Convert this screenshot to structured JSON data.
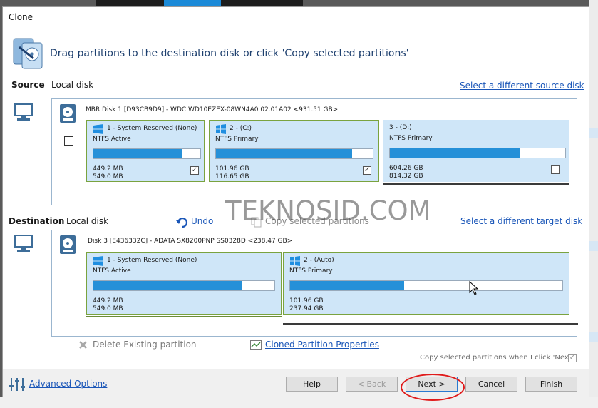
{
  "window": {
    "title": "Clone"
  },
  "header": {
    "instruction": "Drag partitions to the destination disk or click 'Copy selected partitions'"
  },
  "source": {
    "label": "Source",
    "sublabel": "Local disk",
    "select_link": "Select a different source disk",
    "disk_title": "MBR Disk 1 [D93CB9D9] - WDC WD10EZEX-08WN4A0 02.01A02  <931.51 GB>",
    "partitions": [
      {
        "name": "1 - System Reserved (None)",
        "fs": "NTFS Active",
        "used": "449.2 MB",
        "total": "549.0 MB",
        "fill": 0.83,
        "checked": true,
        "has_logo": true
      },
      {
        "name": "2 - (C:)",
        "fs": "NTFS Primary",
        "used": "101.96 GB",
        "total": "116.65 GB",
        "fill": 0.87,
        "checked": true,
        "has_logo": true
      },
      {
        "name": "3 - (D:)",
        "fs": "NTFS Primary",
        "used": "604.26 GB",
        "total": "814.32 GB",
        "fill": 0.74,
        "checked": false,
        "has_logo": false
      }
    ]
  },
  "destination": {
    "label": "Destination",
    "sublabel": "Local disk",
    "undo": "Undo",
    "copy_selected": "Copy selected partitions",
    "select_link": "Select a different target disk",
    "disk_title": "Disk 3 [E436332C] - ADATA SX8200PNP SS0328D  <238.47 GB>",
    "partitions": [
      {
        "name": "1 - System Reserved (None)",
        "fs": "NTFS Active",
        "used": "449.2 MB",
        "total": "549.0 MB",
        "fill": 0.82
      },
      {
        "name": "2 - (Auto)",
        "fs": "NTFS Primary",
        "used": "101.96 GB",
        "total": "237.94 GB",
        "fill": 0.42
      }
    ]
  },
  "actions": {
    "delete_partition": "Delete Existing partition",
    "cloned_properties": "Cloned Partition Properties",
    "copy_on_next": "Copy selected partitions when I click 'Next'"
  },
  "footer": {
    "advanced_options": "Advanced Options",
    "help": "Help",
    "back": "< Back",
    "next": "Next >",
    "cancel": "Cancel",
    "finish": "Finish"
  },
  "watermark": "TEKNOSID.COM",
  "colors": {
    "accent": "#2590d8",
    "link": "#1a56b8",
    "partition_bg": "#cfe6f8",
    "partition_border": "#7aa33f",
    "highlight": "#e01b1b"
  }
}
